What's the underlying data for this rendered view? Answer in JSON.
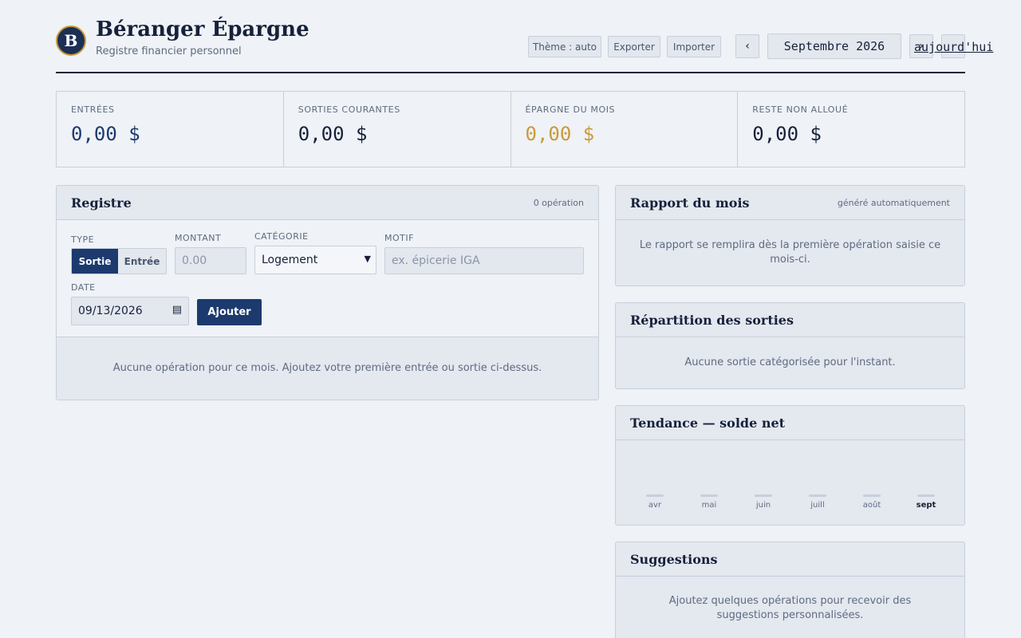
{
  "header": {
    "logo_letter": "B",
    "title": "Béranger Épargne",
    "subtitle": "Registre financier personnel",
    "theme_btn": "Thème : auto",
    "export_btn": "Exporter",
    "import_btn": "Importer",
    "prev_btn": "‹",
    "month": "Septembre 2026",
    "next_btn": "›",
    "today": "aujourd'hui"
  },
  "stats": [
    {
      "label": "ENTRÉES",
      "value": "0,00 $",
      "color": "#1c3a6e"
    },
    {
      "label": "SORTIES COURANTES",
      "value": "0,00 $",
      "color": "#16213a"
    },
    {
      "label": "ÉPARGNE DU MOIS",
      "value": "0,00 $",
      "color": "#c99a3a"
    },
    {
      "label": "RESTE NON ALLOUÉ",
      "value": "0,00 $",
      "color": "#16213a"
    }
  ],
  "registre": {
    "title": "Registre",
    "count": "0 opération",
    "type_label": "TYPE",
    "type_options": [
      "Sortie",
      "Entrée"
    ],
    "amount_label": "MONTANT",
    "amount_placeholder": "0.00",
    "category_label": "CATÉGORIE",
    "category_value": "Logement",
    "reason_label": "MOTIF",
    "reason_placeholder": "ex. épicerie IGA",
    "date_label": "DATE",
    "date_value": "09/13/2026",
    "add_btn": "Ajouter",
    "empty": "Aucune opération pour ce mois. Ajoutez votre première entrée ou sortie ci-dessus."
  },
  "rapport": {
    "title": "Rapport du mois",
    "meta": "généré automatiquement",
    "body": "Le rapport se remplira dès la première opération saisie ce mois-ci."
  },
  "repartition": {
    "title": "Répartition des sorties",
    "body": "Aucune sortie catégorisée pour l'instant."
  },
  "tendance": {
    "title": "Tendance — solde net",
    "months": [
      "avr",
      "mai",
      "juin",
      "juill",
      "août",
      "sept"
    ],
    "current": "sept",
    "values": [
      0,
      0,
      0,
      0,
      0,
      0
    ]
  },
  "suggestions": {
    "title": "Suggestions",
    "body": "Ajoutez quelques opérations pour recevoir des suggestions personnalisées."
  }
}
